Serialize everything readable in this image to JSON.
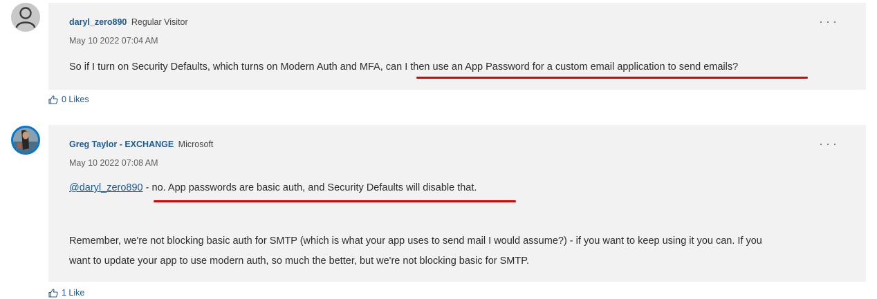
{
  "posts": [
    {
      "author": "daryl_zero890",
      "role": "Regular Visitor",
      "timestamp": "May 10 2022 07:04 AM",
      "body_plain": "So if I turn on Security Defaults, which turns on Modern Auth and MFA, ",
      "body_highlight": "can I then use an App Password for a custom email application to send emails?",
      "likes": "0 Likes"
    },
    {
      "author": "Greg Taylor - EXCHANGE",
      "role": "Microsoft",
      "timestamp": "May 10 2022 07:08 AM",
      "mention": "@daryl_zero890",
      "body_highlight": " - no. App passwords are basic auth, and Security Defaults will disable that.",
      "body_line2": "Remember, we're not blocking basic auth for SMTP (which is what your app uses to send mail I would assume?) - if you want to keep using it you can. If you",
      "body_line3": "want to update your app to use modern auth, so much the better, but we're not blocking basic for SMTP.",
      "likes": "1 Like"
    }
  ],
  "icons": {
    "avatar_1": "user-silhouette-icon",
    "avatar_2": "profile-photo",
    "more": "ellipsis-icon",
    "like": "thumbs-up-icon"
  },
  "colors": {
    "link": "#1b5a96",
    "bubble_bg": "#f2f2f2",
    "annotation": "#e00000",
    "avatar_ring": "#0078d4"
  }
}
